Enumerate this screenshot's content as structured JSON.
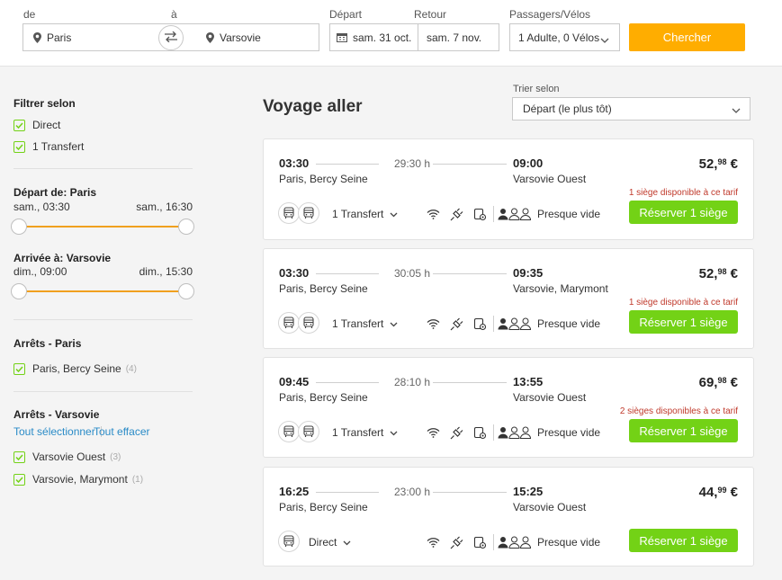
{
  "search": {
    "from_label": "de",
    "to_label": "à",
    "from_value": "Paris",
    "to_value": "Varsovie",
    "depart_label": "Départ",
    "return_label": "Retour",
    "depart_value": "sam. 31 oct.",
    "return_value": "sam. 7 nov.",
    "passengers_label": "Passagers/Vélos",
    "passengers_value": "1 Adulte, 0 Vélos",
    "search_button": "Chercher"
  },
  "sidebar": {
    "filter_title": "Filtrer selon",
    "filters": [
      {
        "label": "Direct",
        "checked": true
      },
      {
        "label": "1 Transfert",
        "checked": true
      }
    ],
    "departure": {
      "title": "Départ de: Paris",
      "min": "sam., 03:30",
      "max": "sam., 16:30"
    },
    "arrival": {
      "title": "Arrivée à: Varsovie",
      "min": "dim., 09:00",
      "max": "dim., 15:30"
    },
    "stops_paris": {
      "title": "Arrêts - Paris",
      "items": [
        {
          "label": "Paris, Bercy Seine",
          "count": "(4)"
        }
      ]
    },
    "stops_warsaw": {
      "title": "Arrêts - Varsovie",
      "select_all": "Tout sélectionner",
      "clear_all": "Tout effacer",
      "items": [
        {
          "label": "Varsovie Ouest",
          "count": "(3)"
        },
        {
          "label": "Varsovie, Marymont",
          "count": "(1)"
        }
      ]
    }
  },
  "main": {
    "title": "Voyage aller",
    "sort_label": "Trier selon",
    "sort_value": "Départ (le plus tôt)",
    "trips": [
      {
        "dep_time": "03:30",
        "duration": "29:30 h",
        "arr_time": "09:00",
        "dep_station": "Paris, Bercy Seine",
        "arr_station": "Varsovie Ouest",
        "price_int": "52,",
        "price_dec": "98",
        "currency": " €",
        "availability": "1 siège disponible à ce tarif",
        "transfer": "1 Transfert",
        "occupancy": "Presque vide",
        "book": "Réserver 1 siège"
      },
      {
        "dep_time": "03:30",
        "duration": "30:05 h",
        "arr_time": "09:35",
        "dep_station": "Paris, Bercy Seine",
        "arr_station": "Varsovie, Marymont",
        "price_int": "52,",
        "price_dec": "98",
        "currency": " €",
        "availability": "1 siège disponible à ce tarif",
        "transfer": "1 Transfert",
        "occupancy": "Presque vide",
        "book": "Réserver 1 siège"
      },
      {
        "dep_time": "09:45",
        "duration": "28:10 h",
        "arr_time": "13:55",
        "dep_station": "Paris, Bercy Seine",
        "arr_station": "Varsovie Ouest",
        "price_int": "69,",
        "price_dec": "98",
        "currency": " €",
        "availability": "2 sièges disponibles à ce tarif",
        "transfer": "1 Transfert",
        "occupancy": "Presque vide",
        "book": "Réserver 1 siège"
      },
      {
        "dep_time": "16:25",
        "duration": "23:00 h",
        "arr_time": "15:25",
        "dep_station": "Paris, Bercy Seine",
        "arr_station": "Varsovie Ouest",
        "price_int": "44,",
        "price_dec": "99",
        "currency": " €",
        "availability": "",
        "transfer": "Direct",
        "occupancy": "Presque vide",
        "book": "Réserver 1 siège"
      }
    ]
  },
  "colors": {
    "accent": "#ffad00",
    "green": "#73d216",
    "link": "#2a8bc7",
    "alert": "#c0392b"
  }
}
